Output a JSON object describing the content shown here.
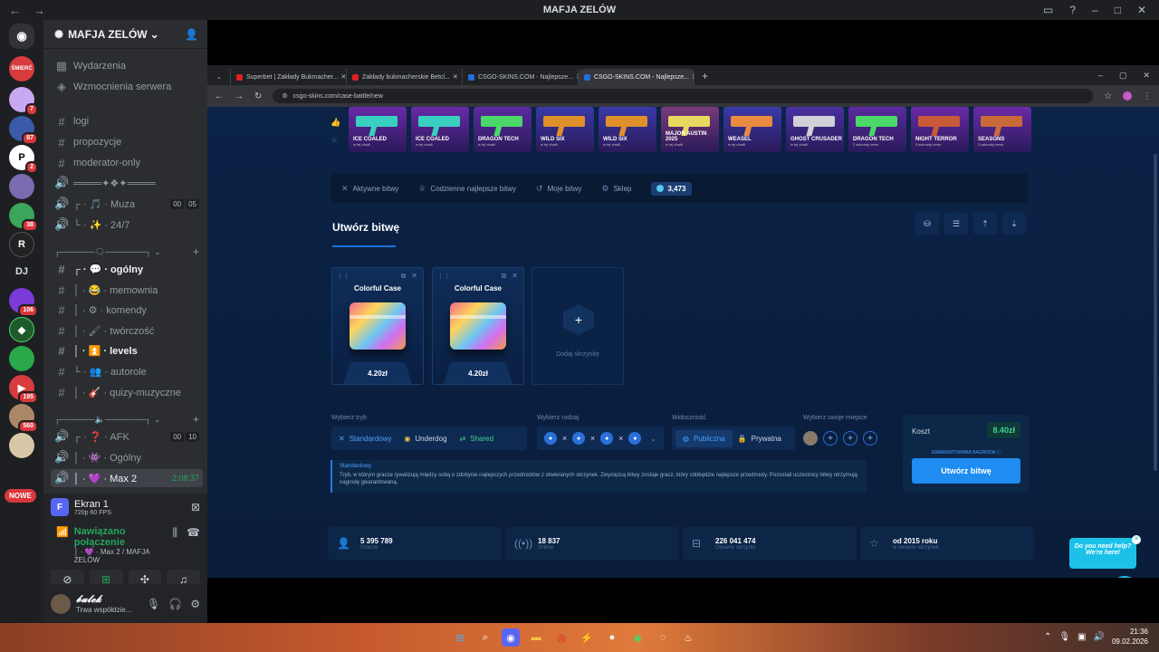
{
  "window": {
    "title": "MAFJA ZELÓW"
  },
  "server": {
    "name": "MAFJA ZELÓW"
  },
  "rail": {
    "badges": [
      "7",
      "87",
      "2",
      "38",
      "106",
      "195",
      "560"
    ],
    "dj": "DJ",
    "nowe": "NOWE",
    "colors": [
      "#d83c3e",
      "#c8a8f0",
      "#3b5ba8",
      "#ffffff",
      "#7a6ab0",
      "#3ba55c",
      "#222222",
      "#7b3bd8",
      "#2aa84a",
      "#d83c3e",
      "#aa8866",
      "#d8c8a8"
    ]
  },
  "channels": {
    "events": "Wydarzenia",
    "boosts": "Wzmocnienia serwera",
    "items": [
      {
        "name": "logi"
      },
      {
        "name": "propozycje"
      },
      {
        "name": "moderator-only"
      },
      {
        "name": "════✦❖✦════"
      },
      {
        "name": "┌ · 🎵 · Muza",
        "c1": "00",
        "c2": "05"
      },
      {
        "name": "└ · ✨ · 24/7"
      }
    ],
    "cat1": "┌──────🗨───────┐",
    "items2": [
      {
        "name": "┌ · 💬 · ogólny"
      },
      {
        "name": "│ · 😂 · memownia"
      },
      {
        "name": "│ · ⚙ · komendy"
      },
      {
        "name": "│ · 🖌 · twórczość"
      },
      {
        "name": "│ · ⏫ · levels"
      },
      {
        "name": "└ · 👥 · autorole"
      },
      {
        "name": "│ · 🎸 · quizy-muzyczne"
      }
    ],
    "cat2": "┌──────🔈───────┐",
    "items3": [
      {
        "name": "┌ · ❓ · AFK",
        "c1": "00",
        "c2": "10"
      },
      {
        "name": "│ · 👾 · Ogólny"
      },
      {
        "name": "│ · 💜 · Max 2",
        "time": "2:08:37"
      }
    ]
  },
  "panel": {
    "stream_icon": "F",
    "stream_name": "Ekran 1",
    "stream_sub": "720p 60 FPS",
    "conn_title": "Nawiązano połączenie",
    "conn_sub": "│ · 💜 · Max 2 / MAFJA ZELÓW"
  },
  "user": {
    "name": "𝓫𝓾𝓵𝓮𝓴",
    "status": "Trwa współdzie..."
  },
  "browser": {
    "tabs": [
      {
        "label": "Superbet | Zakłady Bukmacher...",
        "color": "#e02020"
      },
      {
        "label": "Zakłady bukmacherskie Betcl...",
        "color": "#e02020"
      },
      {
        "label": "CSGO-SKINS.COM - Najlepsze...",
        "color": "#1e6fd6"
      },
      {
        "label": "CSGO-SKINS.COM - Najlepsze...",
        "color": "#1e6fd6"
      }
    ],
    "url": "csgo-skins.com/case-battle/new"
  },
  "skins": [
    {
      "name": "ICE COALED",
      "sub": "w tej chwili",
      "bg": "#6a2aa8",
      "gun": "#3ad0c0"
    },
    {
      "name": "ICE COALED",
      "sub": "w tej chwili",
      "bg": "#6a2aa8",
      "gun": "#3ad0c0"
    },
    {
      "name": "DRAGON TECH",
      "sub": "w tej chwili",
      "bg": "#5b2aa0",
      "gun": "#4ad86a"
    },
    {
      "name": "WILD SIX",
      "sub": "w tej chwili",
      "bg": "#3a3aa8",
      "gun": "#e0902a"
    },
    {
      "name": "WILD SIX",
      "sub": "w tej chwili",
      "bg": "#3a3aa8",
      "gun": "#e0902a"
    },
    {
      "name": "MAJOR AUSTIN 2025",
      "sub": "w tej chwili",
      "bg": "#7a3a7a",
      "gun": "#e8d860"
    },
    {
      "name": "WEASEL",
      "sub": "w tej chwili",
      "bg": "#3a3aa8",
      "gun": "#e88a40"
    },
    {
      "name": "GHOST CRUSADER",
      "sub": "w tej chwili",
      "bg": "#4a30a0",
      "gun": "#d0d0d8"
    },
    {
      "name": "DRAGON TECH",
      "sub": "2 sekundy temu",
      "bg": "#5b2aa0",
      "gun": "#4ad86a"
    },
    {
      "name": "NIGHT TERROR",
      "sub": "3 sekundy temu",
      "bg": "#6a2aa8",
      "gun": "#c85a3a"
    },
    {
      "name": "SEASONS",
      "sub": "3 sekundy temu",
      "bg": "#6a2aa8",
      "gun": "#c86a3a"
    }
  ],
  "menu": {
    "active": "Aktywne bitwy",
    "daily": "Codzienne najlepsze bitwy",
    "mine": "Moje bitwy",
    "shop": "Sklep",
    "coins": "3,473"
  },
  "create": {
    "title": "Utwórz bitwę",
    "cases": [
      {
        "name": "Colorful Case",
        "price": "4.20zł"
      },
      {
        "name": "Colorful Case",
        "price": "4.20zł"
      }
    ],
    "add_label": "Dodaj skrzynkę"
  },
  "options": {
    "mode_label": "Wybierz tryb",
    "mode_standard": "Standardowy",
    "mode_underdog": "Underdog",
    "mode_shared": "Shared",
    "type_label": "Wybierz rodzaj",
    "vis_label": "Widoczność",
    "vis_public": "Publiczna",
    "vis_private": "Prywatna",
    "seat_label": "Wybierz swoje miejsce"
  },
  "desc": {
    "title": "Standardowy",
    "text": "Tryb, w którym gracze rywalizują między sobą o zdobycie najlepszych przedmiotów z otwieranych skrzynek. Zwycięzcą bitwy zostaje gracz, który zdobędzie najlepsze przedmioty. Pozostali uczestnicy bitwy otrzymują nagrodę gwarantowaną."
  },
  "cost": {
    "label": "Koszt",
    "value": "8.40zł",
    "guarantee": "GWARANTOWANA NAGRODA ⓘ",
    "button": "Utwórz bitwę"
  },
  "stats": [
    {
      "value": "5 395 789",
      "label": "Gracze"
    },
    {
      "value": "18 837",
      "label": "Online"
    },
    {
      "value": "226 041 474",
      "label": "Otwarte skrzynki"
    },
    {
      "value": "od 2015 roku",
      "label": "w świecie skrzynek"
    }
  ],
  "help": {
    "text": "Do you need help? We're here!"
  },
  "clock": {
    "time": "21:36",
    "date": "09.02.2026"
  }
}
